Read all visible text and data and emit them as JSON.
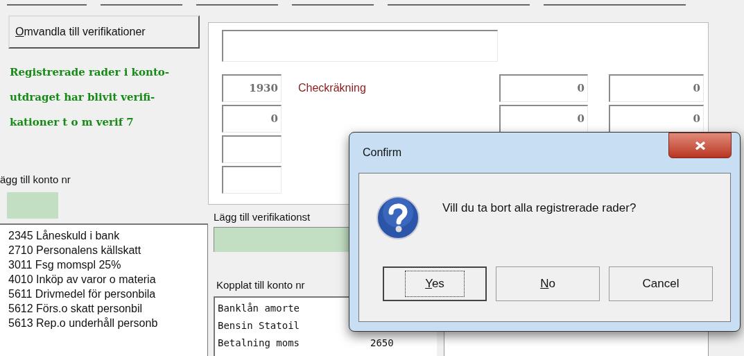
{
  "convert_button": "Omvandla till verifikationer",
  "status_message": [
    "Registrerade rader i konto-",
    "utdraget har blivit verifi-",
    "kationer t o m verif 7"
  ],
  "account_label": "ägg till konto nr",
  "accounts": [
    "2345 Låneskuld i bank",
    "2710 Personalens källskatt",
    "3011 Fsg momspl 25%",
    "4010 Inköp av varor o materia",
    "5611 Drivmedel för personbila",
    "5612 Förs.o skatt personbil",
    "5613 Rep.o underhåll personb"
  ],
  "panel": {
    "rows": [
      {
        "account": "1930",
        "name": "Checkräkning",
        "debit": "0",
        "credit": "0"
      },
      {
        "account": "0",
        "debit": "0",
        "credit": "0"
      },
      {
        "account": ""
      },
      {
        "account": ""
      }
    ]
  },
  "template_label": "Lägg till verifikationst",
  "linked_label": "Kopplat till konto nr",
  "templates": [
    {
      "text": "Banklån amorte"
    },
    {
      "text": "Bensin Statoil"
    },
    {
      "text": "Betalning moms",
      "account": "2650"
    }
  ],
  "dialog": {
    "title": "Confirm",
    "message": "Vill du ta bort alla registrerade rader?",
    "buttons": [
      {
        "label": "Yes",
        "focused": true
      },
      {
        "label": "No",
        "focused": false
      },
      {
        "label": "Cancel",
        "focused": false
      }
    ]
  }
}
